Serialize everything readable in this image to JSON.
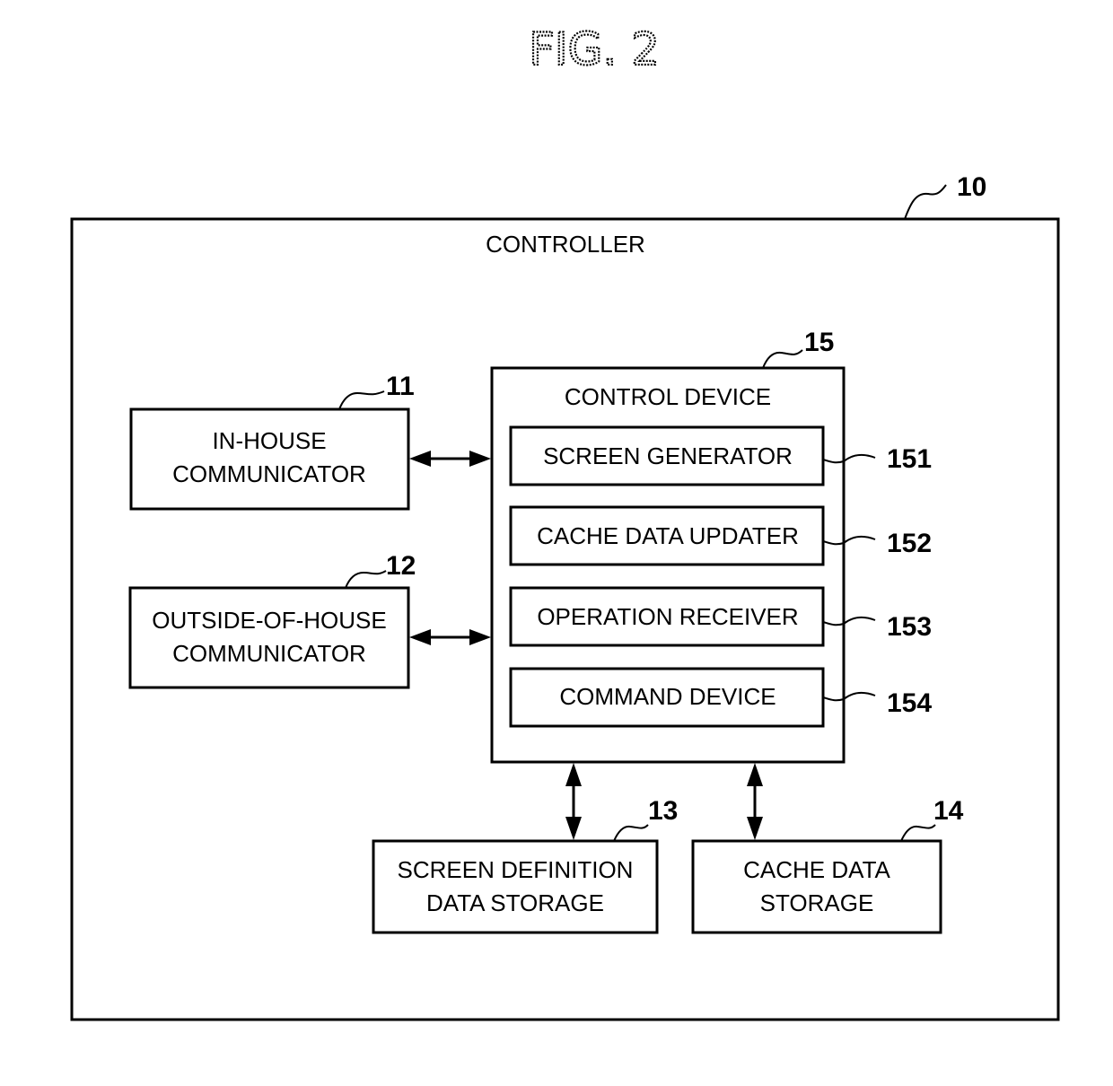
{
  "figure": {
    "title": "FIG. 2"
  },
  "controller": {
    "label": "CONTROLLER",
    "ref": "10"
  },
  "in_house": {
    "line1": "IN-HOUSE",
    "line2": "COMMUNICATOR",
    "ref": "11"
  },
  "outside_house": {
    "line1": "OUTSIDE-OF-HOUSE",
    "line2": "COMMUNICATOR",
    "ref": "12"
  },
  "screen_def_storage": {
    "line1": "SCREEN DEFINITION",
    "line2": "DATA STORAGE",
    "ref": "13"
  },
  "cache_storage": {
    "line1": "CACHE DATA",
    "line2": "STORAGE",
    "ref": "14"
  },
  "control_device": {
    "label": "CONTROL DEVICE",
    "ref": "15",
    "modules": [
      {
        "label": "SCREEN GENERATOR",
        "ref": "151"
      },
      {
        "label": "CACHE DATA UPDATER",
        "ref": "152"
      },
      {
        "label": "OPERATION RECEIVER",
        "ref": "153"
      },
      {
        "label": "COMMAND DEVICE",
        "ref": "154"
      }
    ]
  },
  "connections": [
    {
      "from": "IN-HOUSE COMMUNICATOR",
      "to": "CONTROL DEVICE",
      "type": "bidirectional"
    },
    {
      "from": "OUTSIDE-OF-HOUSE COMMUNICATOR",
      "to": "CONTROL DEVICE",
      "type": "bidirectional"
    },
    {
      "from": "CONTROL DEVICE",
      "to": "SCREEN DEFINITION DATA STORAGE",
      "type": "bidirectional"
    },
    {
      "from": "CONTROL DEVICE",
      "to": "CACHE DATA STORAGE",
      "type": "bidirectional"
    }
  ]
}
